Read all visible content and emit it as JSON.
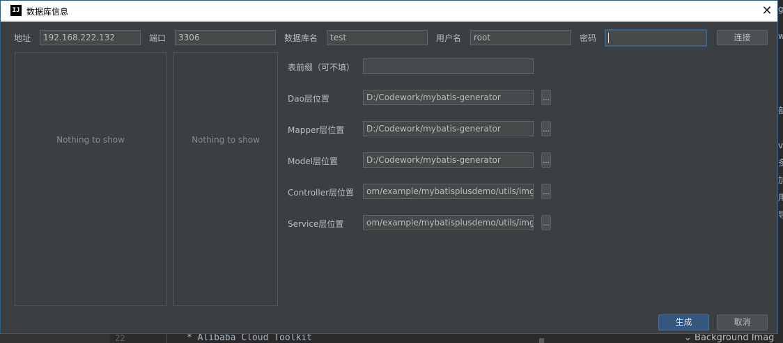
{
  "dialog": {
    "title": "数据库信息",
    "close_glyph": "✕",
    "app_icon_label": "IJ"
  },
  "connection": {
    "address_label": "地址",
    "address_value": "192.168.222.132",
    "port_label": "端口",
    "port_value": "3306",
    "dbname_label": "数据库名",
    "dbname_value": "test",
    "user_label": "用户名",
    "user_value": "root",
    "password_label": "密码",
    "password_value": "",
    "connect_label": "连接"
  },
  "lists": {
    "left_empty": "Nothing to show",
    "middle_empty": "Nothing to show"
  },
  "form": {
    "prefix_label": "表前缀（可不填）",
    "prefix_value": "",
    "dao_label": "Dao层位置",
    "dao_value": "D:/Codework/mybatis-generator",
    "mapper_label": "Mapper层位置",
    "mapper_value": "D:/Codework/mybatis-generator",
    "model_label": "Model层位置",
    "model_value": "D:/Codework/mybatis-generator",
    "controller_label": "Controller层位置",
    "controller_value": "om/example/mybatisplusdemo/utils/img",
    "service_label": "Service层位置",
    "service_value": "om/example/mybatisplusdemo/utils/img",
    "browse_label": "..."
  },
  "footer": {
    "generate_label": "生成",
    "cancel_label": "取消"
  },
  "background": {
    "line_number": "22",
    "code_line": "* Alibaba Cloud Toolkit",
    "right_item": "Background Imag",
    "edge_chars": [
      "g",
      "w",
      "部",
      "v",
      "多",
      "加",
      "用",
      "导"
    ]
  },
  "colors": {
    "dialog_bg": "#3c3f41",
    "field_bg": "#45494a",
    "primary_button": "#365880",
    "focus_border": "#3d6185"
  }
}
